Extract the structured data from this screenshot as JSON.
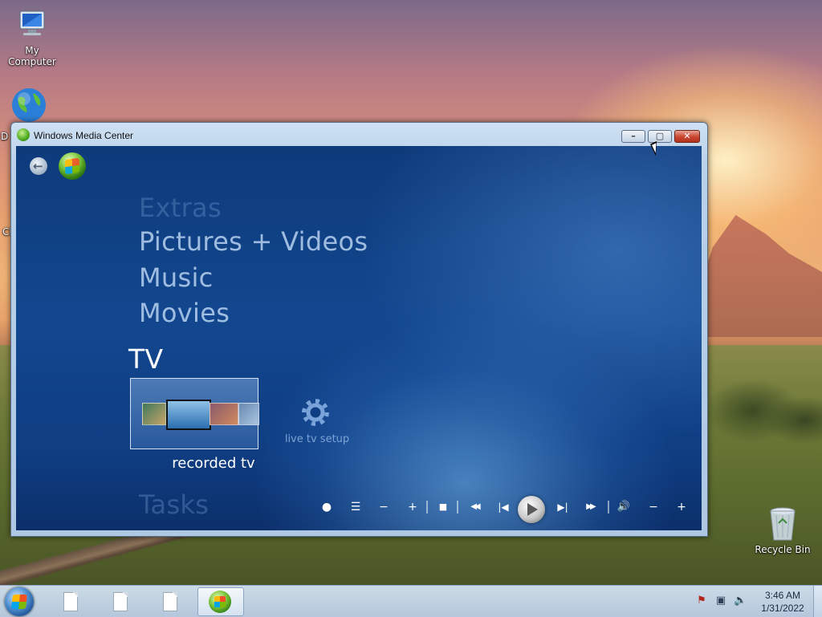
{
  "desktop": {
    "icons": [
      {
        "label": "My Computer",
        "icon": "computer-icon"
      },
      {
        "label": "D",
        "icon": "globe-icon"
      },
      {
        "label": "Cl",
        "icon": "partial-icon"
      },
      {
        "label": "Recycle Bin",
        "icon": "recycle-bin-icon"
      }
    ]
  },
  "window": {
    "title": "Windows Media Center",
    "buttons": {
      "minimize": "–",
      "maximize": "▢",
      "close": "✕"
    }
  },
  "media_center": {
    "nav": {
      "back_icon": "back-arrow-icon",
      "start_icon": "start-orb-icon"
    },
    "menu": [
      "Extras",
      "Pictures + Videos",
      "Music",
      "Movies"
    ],
    "selected_menu": "TV",
    "tiles": [
      {
        "label": "recorded tv",
        "selected": true
      },
      {
        "label": "live tv setup",
        "selected": false
      }
    ],
    "next_menu": "Tasks",
    "transport": [
      {
        "name": "record",
        "glyph": "●"
      },
      {
        "name": "guide",
        "glyph": "☰"
      },
      {
        "name": "channel-down",
        "glyph": "−"
      },
      {
        "name": "channel-up",
        "glyph": "+"
      },
      {
        "name": "stop",
        "glyph": "■"
      },
      {
        "name": "rewind",
        "glyph": "◀◀"
      },
      {
        "name": "skip-back",
        "glyph": "|◀"
      },
      {
        "name": "play",
        "glyph": "▶"
      },
      {
        "name": "skip-forward",
        "glyph": "▶|"
      },
      {
        "name": "fast-forward",
        "glyph": "▶▶"
      },
      {
        "name": "mute",
        "glyph": "🔊"
      },
      {
        "name": "volume-down",
        "glyph": "−"
      },
      {
        "name": "volume-up",
        "glyph": "+"
      }
    ]
  },
  "taskbar": {
    "clock": {
      "time": "3:46 AM",
      "date": "1/31/2022"
    },
    "tray_icons": [
      "action-center-icon",
      "network-icon",
      "volume-icon"
    ],
    "buttons": [
      "document-icon",
      "document-icon",
      "document-icon",
      "media-center-icon"
    ]
  }
}
